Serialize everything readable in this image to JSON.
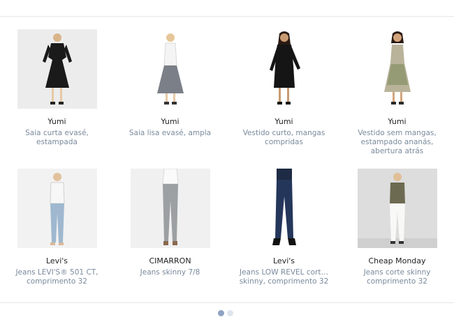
{
  "products": [
    {
      "brand": "Yumi",
      "description": "Saia curta evasé, estampada",
      "image": "woman-black-lace-dress-photo"
    },
    {
      "brand": "Yumi",
      "description": "Saia lisa evasé, ampla",
      "image": "woman-grey-skirt-photo"
    },
    {
      "brand": "Yumi",
      "description": "Vestido curto, mangas compridas",
      "image": "woman-black-long-sleeve-dress-photo"
    },
    {
      "brand": "Yumi",
      "description": "Vestido sem mangas, estampado ananás, abertura atrás",
      "image": "woman-pineapple-print-dress-photo"
    },
    {
      "brand": "Levi's",
      "description": "Jeans  LEVI'S® 501 CT, comprimento 32",
      "image": "woman-light-jeans-photo"
    },
    {
      "brand": "CIMARRON",
      "description": "Jeans skinny 7/8",
      "image": "woman-grey-skinny-jeans-photo"
    },
    {
      "brand": "Levi's",
      "description": "Jeans LOW REVEL cort…",
      "description_line2": "skinny, comprimento 32",
      "image": "woman-dark-skinny-jeans-photo"
    },
    {
      "brand": "Cheap Monday",
      "description": "Jeans corte skinny comprimento 32",
      "image": "woman-white-jeans-photo"
    }
  ],
  "pager": {
    "pages": 2,
    "current": 1
  },
  "colors": {
    "brand_text": "#222222",
    "description_text": "#7a8a9c",
    "pager_active": "#8fa3c2",
    "pager_inactive": "#dfe5ee",
    "divider": "#e6e6e6"
  }
}
